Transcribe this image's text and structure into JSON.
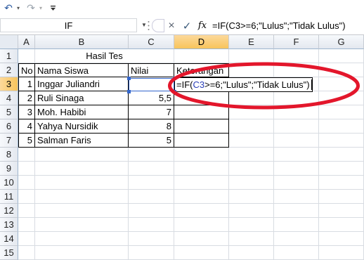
{
  "toolbar": {
    "undo_icon": "undo-icon",
    "redo_icon": "redo-icon",
    "customize_icon": "customize-qat-icon"
  },
  "formula_bar": {
    "name_box": "IF",
    "cancel_icon": "×",
    "enter_icon": "✓",
    "fx_label": "fx",
    "formula": "=IF(C3>=6;\"Lulus\";\"Tidak Lulus\")"
  },
  "columns": [
    "A",
    "B",
    "C",
    "D",
    "E",
    "F",
    "G"
  ],
  "rows": [
    "1",
    "2",
    "3",
    "4",
    "5",
    "6",
    "7",
    "8",
    "9",
    "10",
    "11",
    "12",
    "13",
    "14",
    "15"
  ],
  "table": {
    "title": "Hasil Tes",
    "headers": {
      "no": "No",
      "nama": "Nama Siswa",
      "nilai": "Nilai",
      "keterangan": "Keterangan"
    },
    "records": [
      {
        "no": "1",
        "nama": "Inggar Juliandri",
        "nilai": ""
      },
      {
        "no": "2",
        "nama": "Ruli Sinaga",
        "nilai": "5,5"
      },
      {
        "no": "3",
        "nama": "Moh. Habibi",
        "nilai": "7"
      },
      {
        "no": "4",
        "nama": "Yahya Nursidik",
        "nilai": "8"
      },
      {
        "no": "5",
        "nama": "Salman Faris",
        "nilai": "5"
      }
    ]
  },
  "edit": {
    "prefix": "=IF(",
    "ref": "C3",
    "suffix": ">=6;\"Lulus\";\"Tidak Lulus\")"
  },
  "colors": {
    "annotation": "#e3162b",
    "ref": "#2b3fb8",
    "selected_header": "#f8c45b"
  }
}
